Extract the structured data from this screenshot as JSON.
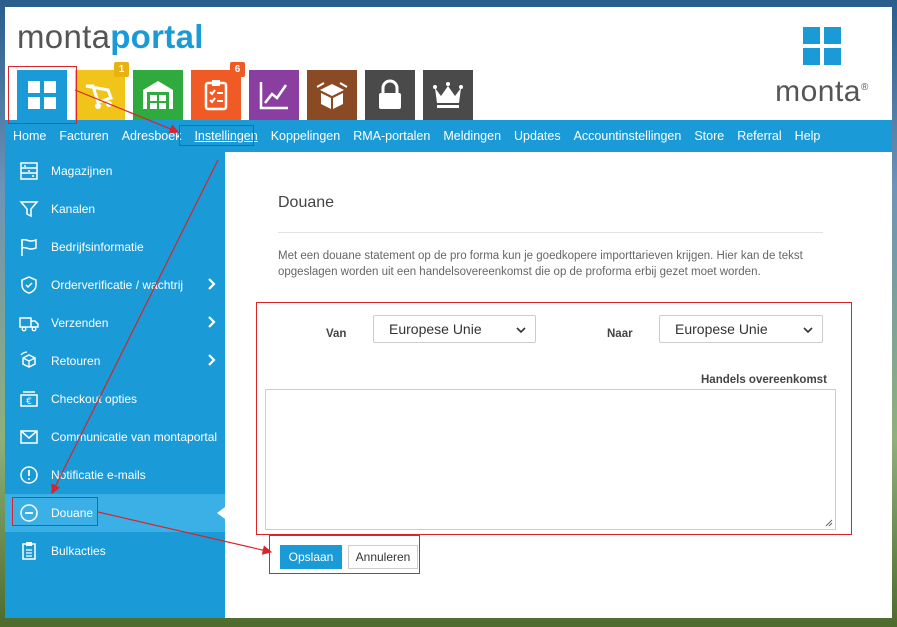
{
  "logo": {
    "part1": "monta",
    "part2": "portal"
  },
  "brand": {
    "word": "monta",
    "reg": "®"
  },
  "tiles": [
    {
      "icon": "apps-grid-icon",
      "color": "#1a9ad6",
      "badge": ""
    },
    {
      "icon": "cart-icon",
      "color": "#f0c419",
      "badge": "1",
      "badge_color": "#e9b213"
    },
    {
      "icon": "warehouse-icon",
      "color": "#2eaa3e",
      "badge": ""
    },
    {
      "icon": "checklist-icon",
      "color": "#f05a24",
      "badge": "6",
      "badge_color": "#f05a24"
    },
    {
      "icon": "chart-icon",
      "color": "#8a3fa0",
      "badge": ""
    },
    {
      "icon": "box-icon",
      "color": "#8a4a23",
      "badge": ""
    },
    {
      "icon": "lock-icon",
      "color": "#4a4a4a",
      "badge": ""
    },
    {
      "icon": "crown-icon",
      "color": "#4a4a4a",
      "badge": ""
    }
  ],
  "nav": {
    "items": [
      "Home",
      "Facturen",
      "Adresboek",
      "Instellingen",
      "Koppelingen",
      "RMA-portalen",
      "Meldingen",
      "Updates",
      "Accountinstellingen",
      "Store",
      "Referral",
      "Help"
    ],
    "active": "Instellingen"
  },
  "sidebar": {
    "items": [
      {
        "label": "Magazijnen",
        "icon": "shelves-icon"
      },
      {
        "label": "Kanalen",
        "icon": "funnel-icon"
      },
      {
        "label": "Bedrijfsinformatie",
        "icon": "flag-icon"
      },
      {
        "label": "Orderverificatie / wachtrij",
        "icon": "shield-check-icon",
        "arrow": true
      },
      {
        "label": "Verzenden",
        "icon": "truck-icon",
        "arrow": true
      },
      {
        "label": "Retouren",
        "icon": "return-box-icon",
        "arrow": true
      },
      {
        "label": "Checkout opties",
        "icon": "euro-card-icon"
      },
      {
        "label": "Communicatie van montaportal",
        "icon": "envelope-icon"
      },
      {
        "label": "Notificatie e-mails",
        "icon": "exclamation-circle-icon"
      },
      {
        "label": "Douane",
        "icon": "minus-circle-icon",
        "active": true
      },
      {
        "label": "Bulkacties",
        "icon": "clipboard-icon"
      }
    ]
  },
  "page": {
    "title": "Douane",
    "description": "Met een douane statement op de pro forma kun je goedkopere importtarieven krijgen. Hier kan de tekst opgeslagen worden uit een handelsovereenkomst die op de proforma erbij gezet moet worden.",
    "van_label": "Van",
    "van_value": "Europese Unie",
    "naar_label": "Naar",
    "naar_value": "Europese Unie",
    "textarea_label": "Handels overeenkomst",
    "textarea_value": "",
    "save_label": "Opslaan",
    "cancel_label": "Annuleren"
  },
  "colors": {
    "accent": "#1a9ad6",
    "sidebar_active": "#3bb0e6",
    "annotation": "#d9242a"
  }
}
